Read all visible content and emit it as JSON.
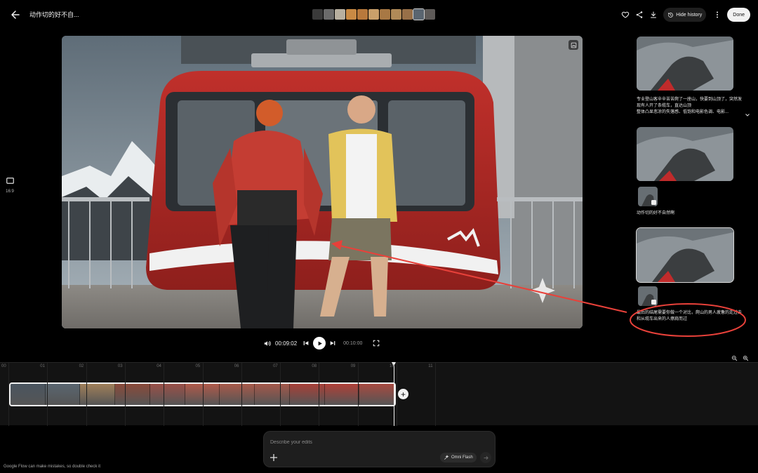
{
  "header": {
    "title": "动作切的好不自...",
    "hide_history_label": "Hide history",
    "done_label": "Done",
    "thumbnail_colors": [
      "#3a3a3a",
      "#6b6b6b",
      "#b8b0a0",
      "#c98a44",
      "#b8793c",
      "#caa06a",
      "#a87844",
      "#b08a58",
      "#987048",
      "#5a6570",
      "#5e5a58"
    ],
    "selected_thumbnail": 9
  },
  "aspect": {
    "label": "16:9"
  },
  "player": {
    "current_time": "00:09:02",
    "total_time": "00:10:00"
  },
  "history": {
    "items": [
      {
        "text": "专业登山客辛辛苦苦爬了一座山，快要到山顶了，突然发现有人开了条缆车，直达山顶\n整体凸显悲凉的失落感、低饱和电影色调、电影..."
      },
      {
        "text": "动作切的好不自然啊"
      },
      {
        "text": "最后的结尾需要你做一个对比，爬山的男人疲惫的走过去和从缆车出来的人擦肩而过"
      }
    ]
  },
  "timeline": {
    "ruler": [
      "00",
      "01",
      "02",
      "03",
      "04",
      "05",
      "06",
      "07",
      "08",
      "09",
      "10",
      "11"
    ],
    "playhead_fraction": 0.9033,
    "frame_colors": [
      "#4a5560",
      "#5a6670",
      "#a0805a",
      "#8a4a3a",
      "#9a5048",
      "#b05a4a",
      "#a85a4a",
      "#a4584a",
      "#a84038",
      "#b04038",
      "#a84a40"
    ]
  },
  "prompt": {
    "placeholder": "Describe your edits",
    "model_label": "Omni Flash"
  },
  "footer": {
    "disclaimer": "Google Flow can make mistakes, so double check it"
  },
  "colors": {
    "accent": "#e8413a",
    "background": "#000000",
    "panel": "#131313"
  }
}
